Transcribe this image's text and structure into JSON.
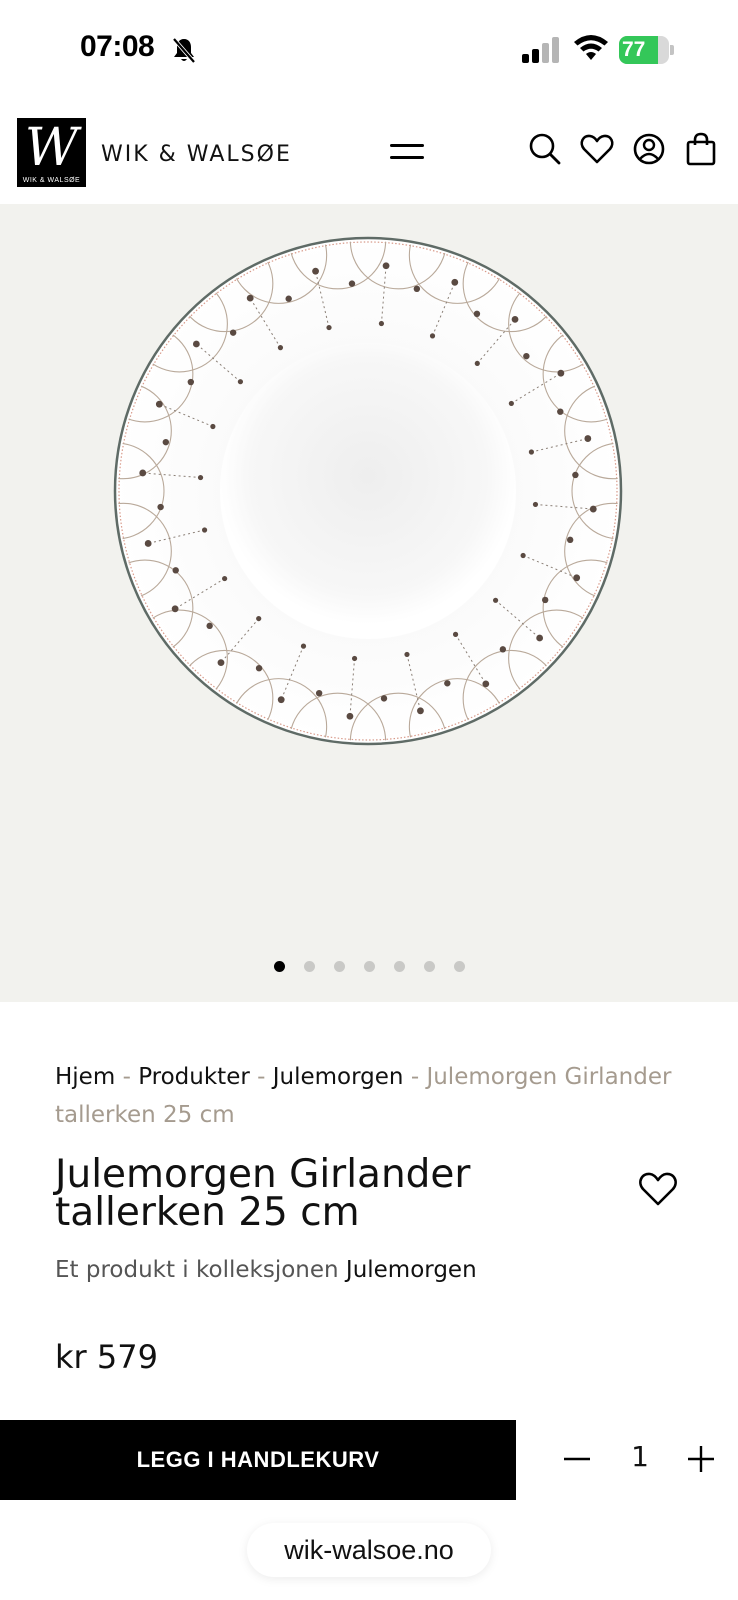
{
  "status_bar": {
    "time": "07:08",
    "battery_level": "77",
    "battery_fraction": 0.77,
    "icons": [
      "bell-slash-icon",
      "cellular-signal-icon",
      "wifi-icon",
      "battery-icon"
    ]
  },
  "header": {
    "logo_text": "W",
    "logo_subtext": "WIK & WALSØE",
    "brand_name": "WIK & WALSØE",
    "icons": [
      "menu-icon",
      "search-icon",
      "heart-icon",
      "account-icon",
      "cart-icon"
    ]
  },
  "gallery": {
    "image_count": 7,
    "active_index": 0,
    "background_color": "#f2f2ee"
  },
  "breadcrumb": {
    "items": [
      "Hjem",
      "Produkter",
      "Julemorgen"
    ],
    "separator": "-",
    "current": "Julemorgen Girlander tallerken 25 cm"
  },
  "product": {
    "title": "Julemorgen Girlander tallerken 25 cm",
    "collection_prefix": "Et produkt i kolleksjonen",
    "collection_name": "Julemorgen",
    "price": "kr 579"
  },
  "cart": {
    "add_label": "LEGG I HANDLEKURV",
    "quantity": "1"
  },
  "browser": {
    "url": "wik-walsoe.no"
  },
  "colors": {
    "accent": "#000000",
    "breadcrumb_current": "#a59b8f",
    "battery_green": "#34c759"
  }
}
